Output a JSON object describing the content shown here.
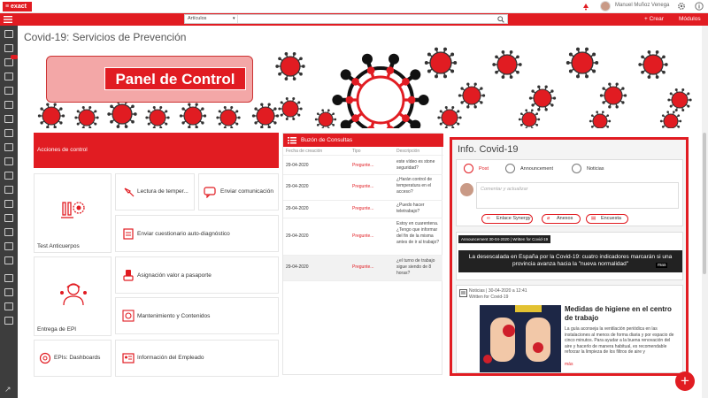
{
  "topbar": {
    "logo": "≡ exact",
    "user_name": "Manuel Muñoz Venega"
  },
  "searchbar": {
    "select_value": "Artículos",
    "crear": "+ Crear",
    "modulos": "Módulos"
  },
  "page": {
    "title": "Covid-19: Servicios de Prevención"
  },
  "banner": {
    "title": "Panel de Control"
  },
  "acciones": {
    "header": "Acciones de control",
    "tiles": {
      "anticuerpos": "Test Anticuerpos",
      "temperatura": "Lectura de temper...",
      "comunicacion": "Enviar comunicación",
      "cuestionario": "Enviar cuestionario auto-diagnóstico",
      "epi": "Entrega de EPI",
      "pasaporte": "Asignación valor a pasaporte",
      "mantenimiento": "Mantenimiento y Contenidos",
      "dashboards": "EPIs: Dashboards",
      "empleado": "Información del Empleado"
    }
  },
  "buzon": {
    "title": "Buzón de Consultas",
    "columns": {
      "fecha": "Fecha de creación",
      "tipo": "Tipo",
      "desc": "Descripción"
    },
    "rows": [
      {
        "fecha": "29-04-2020",
        "tipo": "Pregunte...",
        "desc": "este vídeo es stone seguridad?"
      },
      {
        "fecha": "29-04-2020",
        "tipo": "Pregunte...",
        "desc": "¿Harán control de temperatura en el acceso?"
      },
      {
        "fecha": "29-04-2020",
        "tipo": "Pregunte...",
        "desc": "¿Puedo hacer teletrabajo?"
      },
      {
        "fecha": "29-04-2020",
        "tipo": "Pregunte...",
        "desc": "Estoy en cuarentena. ¿Tengo que informar del fin de la misma antes de ir al trabajo?"
      },
      {
        "fecha": "29-04-2020",
        "tipo": "Pregunte...",
        "desc": "¿el turno de trabajo sigue siendo de 8 horas?"
      }
    ]
  },
  "info": {
    "title": "Info. Covid-19",
    "tabs": {
      "post": "Post",
      "announcement": "Announcement",
      "noticias": "Noticias"
    },
    "compose_placeholder": "Comentar y actualizar",
    "pills": {
      "enlace": "Enlace Synergy",
      "anexos": "Anexos",
      "encuesta": "Encuesta"
    },
    "announcement": {
      "tag": "Announcement  30-04-2020  |  Written for Covid-19",
      "text": "La desescalada en España por la Covid-19: cuatro indicadores marcarán si una provincia avanza hacia la \"nueva normalidad\"",
      "mas": "mas"
    },
    "news": {
      "meta1": "Noticias  |  30-04-2020 a 12:41",
      "meta2": "Written for Covid-19",
      "title": "Medidas de higiene en el centro de trabajo",
      "body": "La guía aconseja la ventilación periódica en las instalaciones al menos de forma diaria y por espacio de cinco minutos. Para ayudar a la buena renovación del aire y hacerlo de manera habitual, es recomendable reforzar la limpieza de los filtros de aire y",
      "mas": "más"
    }
  },
  "fab": {
    "label": "+"
  },
  "colors": {
    "accent": "#e11c22",
    "sidebar": "#3d3d3d"
  }
}
